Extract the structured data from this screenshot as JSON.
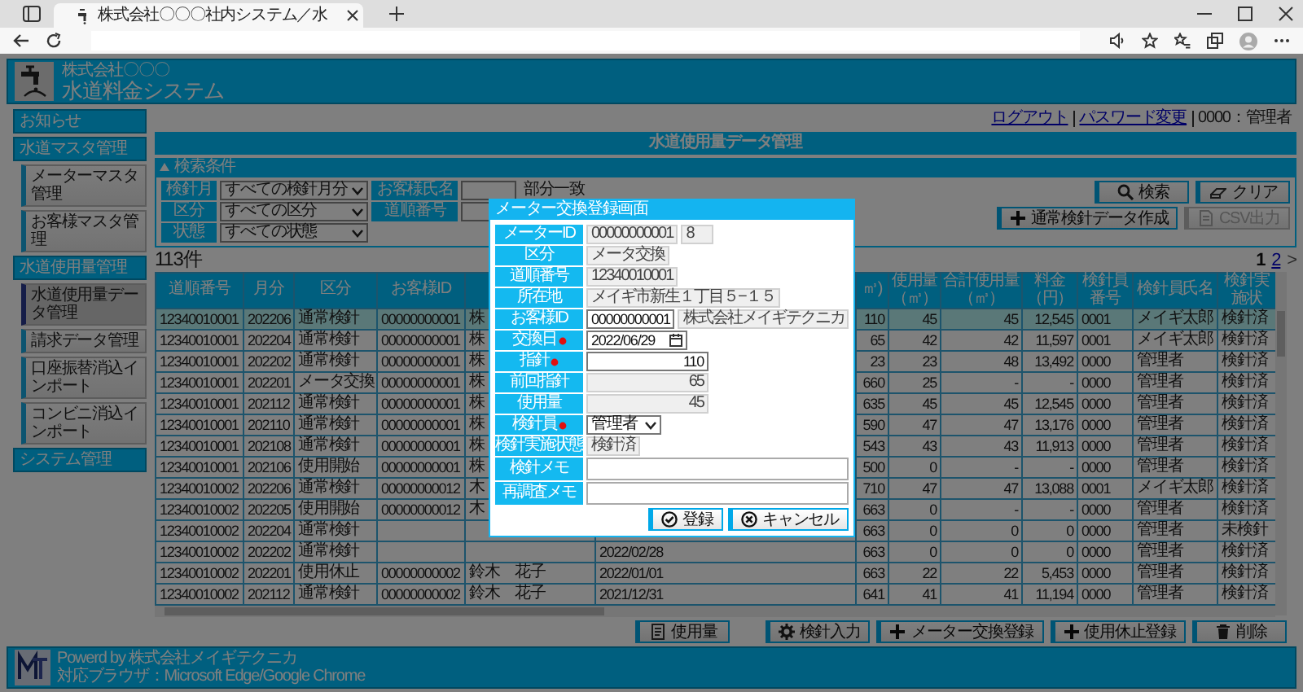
{
  "browser": {
    "tab_title": "株式会社〇〇〇社内システム／水"
  },
  "header": {
    "company": "株式会社〇〇〇",
    "system": "水道料金システム"
  },
  "sidebar": [
    {
      "title": "お知らせ"
    },
    {
      "title": "水道マスタ管理",
      "items": [
        {
          "label": "メーターマスタ管理",
          "selected": false
        },
        {
          "label": "お客様マスタ管理",
          "selected": false
        }
      ]
    },
    {
      "title": "水道使用量管理",
      "items": [
        {
          "label": "水道使用量データ管理",
          "selected": true
        },
        {
          "label": "請求データ管理",
          "selected": false
        },
        {
          "label": "口座振替消込インポート",
          "selected": false
        },
        {
          "label": "コンビニ消込インポート",
          "selected": false
        }
      ]
    },
    {
      "title": "システム管理"
    }
  ],
  "user_bar": [
    {
      "kind": "link",
      "label": "ログアウト"
    },
    {
      "kind": "link",
      "label": "パスワード変更"
    },
    {
      "kind": "text",
      "label": "0000：管理者"
    }
  ],
  "page_title": "水道使用量データ管理",
  "search": {
    "title": "検索条件",
    "expanded": true,
    "filters": [
      {
        "label": "検針月",
        "value": "すべての検針月分"
      },
      {
        "label": "区分",
        "value": "すべての区分"
      },
      {
        "label": "状態",
        "value": "すべての状態"
      }
    ],
    "text_filters": [
      {
        "label": "お客様氏名",
        "hint": "部分一致"
      },
      {
        "label": "道順番号"
      }
    ],
    "buttons": [
      {
        "kind": "search",
        "label": "検索",
        "disabled": false
      },
      {
        "kind": "clear",
        "label": "クリア",
        "disabled": false
      },
      {
        "kind": "add",
        "label": "通常検針データ作成",
        "disabled": false
      },
      {
        "kind": "csv",
        "label": "CSV出力",
        "disabled": true
      }
    ]
  },
  "result": {
    "count": "113件",
    "pages": [
      {
        "label": "1",
        "selected": true
      },
      {
        "label": "2",
        "selected": false
      }
    ],
    "next": ">"
  },
  "table": {
    "columns": [
      "道順番号",
      "月分",
      "区分",
      "お客様ID",
      null,
      null,
      "㎥)",
      "使用量（㎥）",
      "合計使用量（㎥）",
      "料金（円）",
      "検針員番号",
      "検針員氏名",
      "検針実施状"
    ],
    "rows": [
      {
        "selected": true,
        "cells": [
          "12340010001",
          "202206",
          "通常検針",
          "00000000001",
          "株",
          null,
          "110",
          "45",
          "45",
          "12,545",
          "0001",
          "メイギ太郎",
          "検針済"
        ]
      },
      {
        "selected": false,
        "cells": [
          "12340010001",
          "202204",
          "通常検針",
          "00000000001",
          "株",
          null,
          "65",
          "42",
          "42",
          "11,597",
          "0001",
          "メイギ太郎",
          "検針済"
        ]
      },
      {
        "selected": false,
        "cells": [
          "12340010001",
          "202202",
          "通常検針",
          "00000000001",
          "株",
          null,
          "23",
          "23",
          "48",
          "13,492",
          "0000",
          "管理者",
          "検針済"
        ]
      },
      {
        "selected": false,
        "cells": [
          "12340010001",
          "202201",
          "メータ交換",
          "00000000001",
          "株",
          null,
          "660",
          "25",
          "-",
          "-",
          "0000",
          "管理者",
          "検針済"
        ]
      },
      {
        "selected": false,
        "cells": [
          "12340010001",
          "202112",
          "通常検針",
          "00000000001",
          "株",
          null,
          "635",
          "45",
          "45",
          "12,545",
          "0000",
          "管理者",
          "検針済"
        ]
      },
      {
        "selected": false,
        "cells": [
          "12340010001",
          "202110",
          "通常検針",
          "00000000001",
          "株",
          null,
          "590",
          "47",
          "47",
          "13,176",
          "0000",
          "管理者",
          "検針済"
        ]
      },
      {
        "selected": false,
        "cells": [
          "12340010001",
          "202108",
          "通常検針",
          "00000000001",
          "株",
          null,
          "543",
          "43",
          "43",
          "11,913",
          "0000",
          "管理者",
          "検針済"
        ]
      },
      {
        "selected": false,
        "cells": [
          "12340010001",
          "202106",
          "使用開始",
          "00000000001",
          "株",
          null,
          "500",
          "0",
          "-",
          "-",
          "0000",
          "管理者",
          "検針済"
        ]
      },
      {
        "selected": false,
        "cells": [
          "12340010002",
          "202206",
          "通常検針",
          "00000000012",
          "木",
          null,
          "710",
          "47",
          "47",
          "13,088",
          "0001",
          "メイギ太郎",
          "検針済"
        ]
      },
      {
        "selected": false,
        "cells": [
          "12340010002",
          "202205",
          "使用開始",
          "00000000012",
          "木",
          null,
          "663",
          "0",
          "-",
          "-",
          "0000",
          "管理者",
          "検針済"
        ]
      },
      {
        "selected": false,
        "cells": [
          "12340010002",
          "202204",
          "通常検針",
          null,
          null,
          null,
          "663",
          "0",
          "0",
          "0",
          "0000",
          "管理者",
          "未検針"
        ]
      },
      {
        "selected": false,
        "cells": [
          "12340010002",
          "202202",
          "通常検針",
          null,
          null,
          "2022/02/28",
          "663",
          "0",
          "0",
          "0",
          "0000",
          "管理者",
          "検針済"
        ]
      },
      {
        "selected": false,
        "cells": [
          "12340010002",
          "202201",
          "使用休止",
          "00000000002",
          "鈴木　花子",
          "2022/01/01",
          "663",
          "22",
          "22",
          "5,453",
          "0000",
          "管理者",
          "検針済"
        ]
      },
      {
        "selected": false,
        "cells": [
          "12340010002",
          "202112",
          "通常検針",
          "00000000002",
          "鈴木　花子",
          "2021/12/31",
          "641",
          "41",
          "41",
          "11,194",
          "0000",
          "管理者",
          "検針済"
        ]
      }
    ]
  },
  "actions": [
    {
      "kind": "usage",
      "label": "使用量"
    },
    {
      "kind": "gear",
      "label": "検針入力"
    },
    {
      "kind": "add",
      "label": "メーター交換登録"
    },
    {
      "kind": "add",
      "label": "使用休止登録"
    },
    {
      "kind": "delete",
      "label": "削除"
    }
  ],
  "footer": {
    "powered": "Powerd by 株式会社メイギテクニカ",
    "browsers": "対応ブラウザ：Microsoft Edge/Google Chrome"
  },
  "modal": {
    "title": "メーター交換登録画面",
    "rows": [
      {
        "label": "メーターID",
        "required": false,
        "fields": [
          {
            "kind": "text",
            "value": "00000000001"
          },
          {
            "kind": "text",
            "value": "8"
          }
        ]
      },
      {
        "label": "区分",
        "required": false,
        "fields": [
          {
            "kind": "text",
            "value": "メータ交換"
          }
        ]
      },
      {
        "label": "道順番号",
        "required": false,
        "fields": [
          {
            "kind": "text",
            "value": "12340010001"
          }
        ]
      },
      {
        "label": "所在地",
        "required": false,
        "fields": [
          {
            "kind": "text",
            "value": "メイギ市新生１丁目５−１５"
          }
        ]
      },
      {
        "label": "お客様ID",
        "required": false,
        "fields": [
          {
            "kind": "input",
            "value": "00000000001"
          },
          {
            "kind": "text",
            "value": "株式会社メイギテクニカ"
          }
        ]
      },
      {
        "label": "交換日",
        "required": true,
        "fields": [
          {
            "kind": "date",
            "value": "2022/06/29"
          }
        ]
      },
      {
        "label": "指針",
        "required": true,
        "fields": [
          {
            "kind": "input_number",
            "value": "110"
          }
        ]
      },
      {
        "label": "前回指針",
        "required": false,
        "fields": [
          {
            "kind": "number",
            "value": "65"
          }
        ]
      },
      {
        "label": "使用量",
        "required": false,
        "fields": [
          {
            "kind": "number",
            "value": "45"
          }
        ]
      },
      {
        "label": "検針員",
        "required": true,
        "fields": [
          {
            "kind": "select",
            "value": "管理者"
          }
        ]
      },
      {
        "label": "検針実施状態",
        "required": false,
        "fields": [
          {
            "kind": "text",
            "value": "検針済"
          }
        ]
      },
      {
        "label": "検針メモ",
        "required": false,
        "fields": [
          {
            "kind": "textarea"
          }
        ]
      },
      {
        "label": "再調査メモ",
        "required": false,
        "fields": [
          {
            "kind": "textarea"
          }
        ]
      }
    ],
    "buttons": [
      {
        "kind": "ok",
        "label": "登録"
      },
      {
        "kind": "cancel",
        "label": "キャンセル"
      }
    ]
  }
}
